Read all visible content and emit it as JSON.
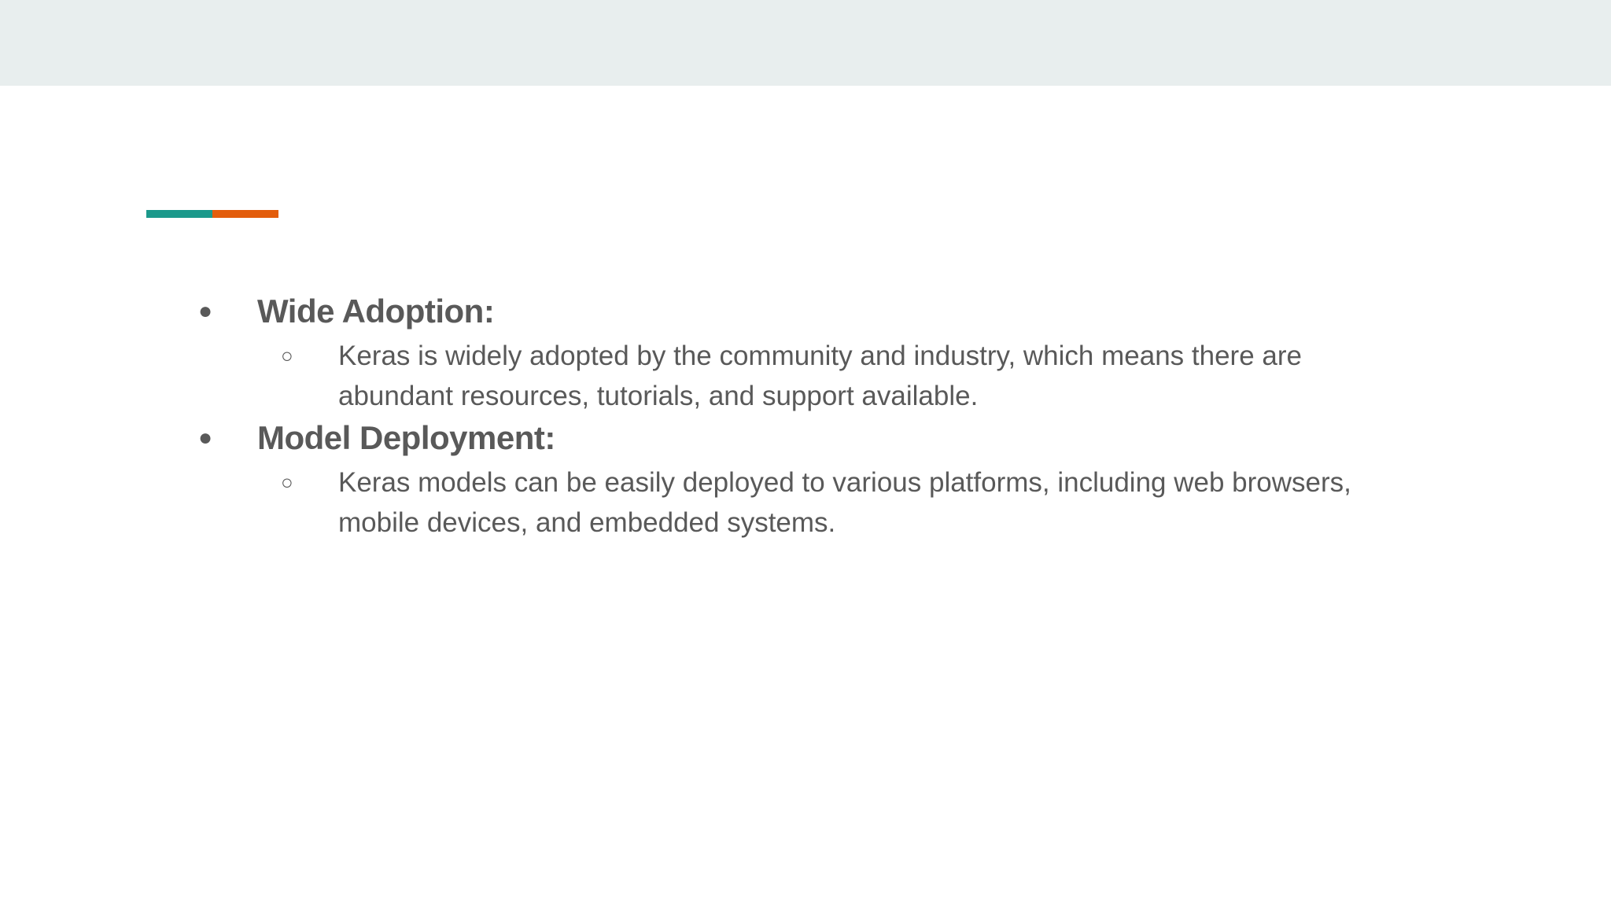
{
  "slide": {
    "accent_colors": [
      "#1b998b",
      "#e35d0c"
    ],
    "items": [
      {
        "heading": "Wide Adoption:",
        "bullet": "●",
        "sub_bullet": "○",
        "detail": "Keras is widely adopted by the community and industry, which means there are abundant resources, tutorials, and support available."
      },
      {
        "heading": "Model Deployment:",
        "bullet": "●",
        "sub_bullet": "○",
        "detail": "Keras models can be easily deployed to various platforms, including web browsers, mobile devices, and embedded systems."
      }
    ]
  }
}
